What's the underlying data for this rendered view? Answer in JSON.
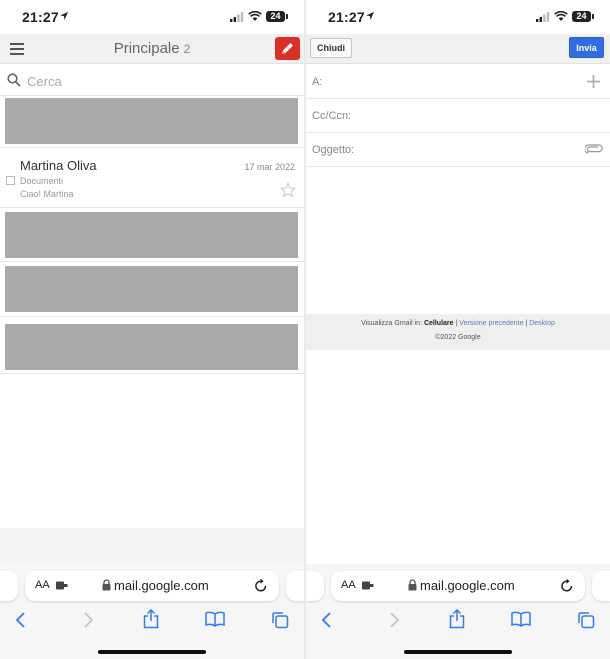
{
  "status_bar": {
    "time": "21:27",
    "battery": "24"
  },
  "inbox": {
    "title": "Principale",
    "count": "2",
    "search_placeholder": "Cerca",
    "message": {
      "sender": "Martina Oliva",
      "date": "17 mar 2022",
      "subject": "Documenti",
      "snippet": "Ciao! Martina"
    }
  },
  "compose": {
    "close_label": "Chiudi",
    "send_label": "Invia",
    "to_label": "A:",
    "cc_label": "Cc/Ccn:",
    "subject_label": "Oggetto:",
    "footer": {
      "prefix": "Visualizza Gmail in:",
      "current": "Cellulare",
      "separator": "|",
      "previous": "Versione precedente",
      "desktop": "Desktop",
      "copyright": "©2022 Google"
    }
  },
  "browser": {
    "text_size_label": "AA",
    "url": "mail.google.com"
  },
  "colors": {
    "compose_accent": "#d93025",
    "send_accent": "#2f6de1",
    "link": "#5a7fb8",
    "safari_blue": "#2f7bf5"
  },
  "icons": [
    "location-arrow-icon",
    "cellular-signal-icon",
    "wifi-icon",
    "battery-icon",
    "menu-icon",
    "pencil-icon",
    "search-icon",
    "star-icon",
    "plus-icon",
    "paperclip-icon",
    "extension-icon",
    "lock-icon",
    "reload-icon",
    "back-icon",
    "forward-icon",
    "share-icon",
    "bookmarks-icon",
    "tabs-icon"
  ]
}
